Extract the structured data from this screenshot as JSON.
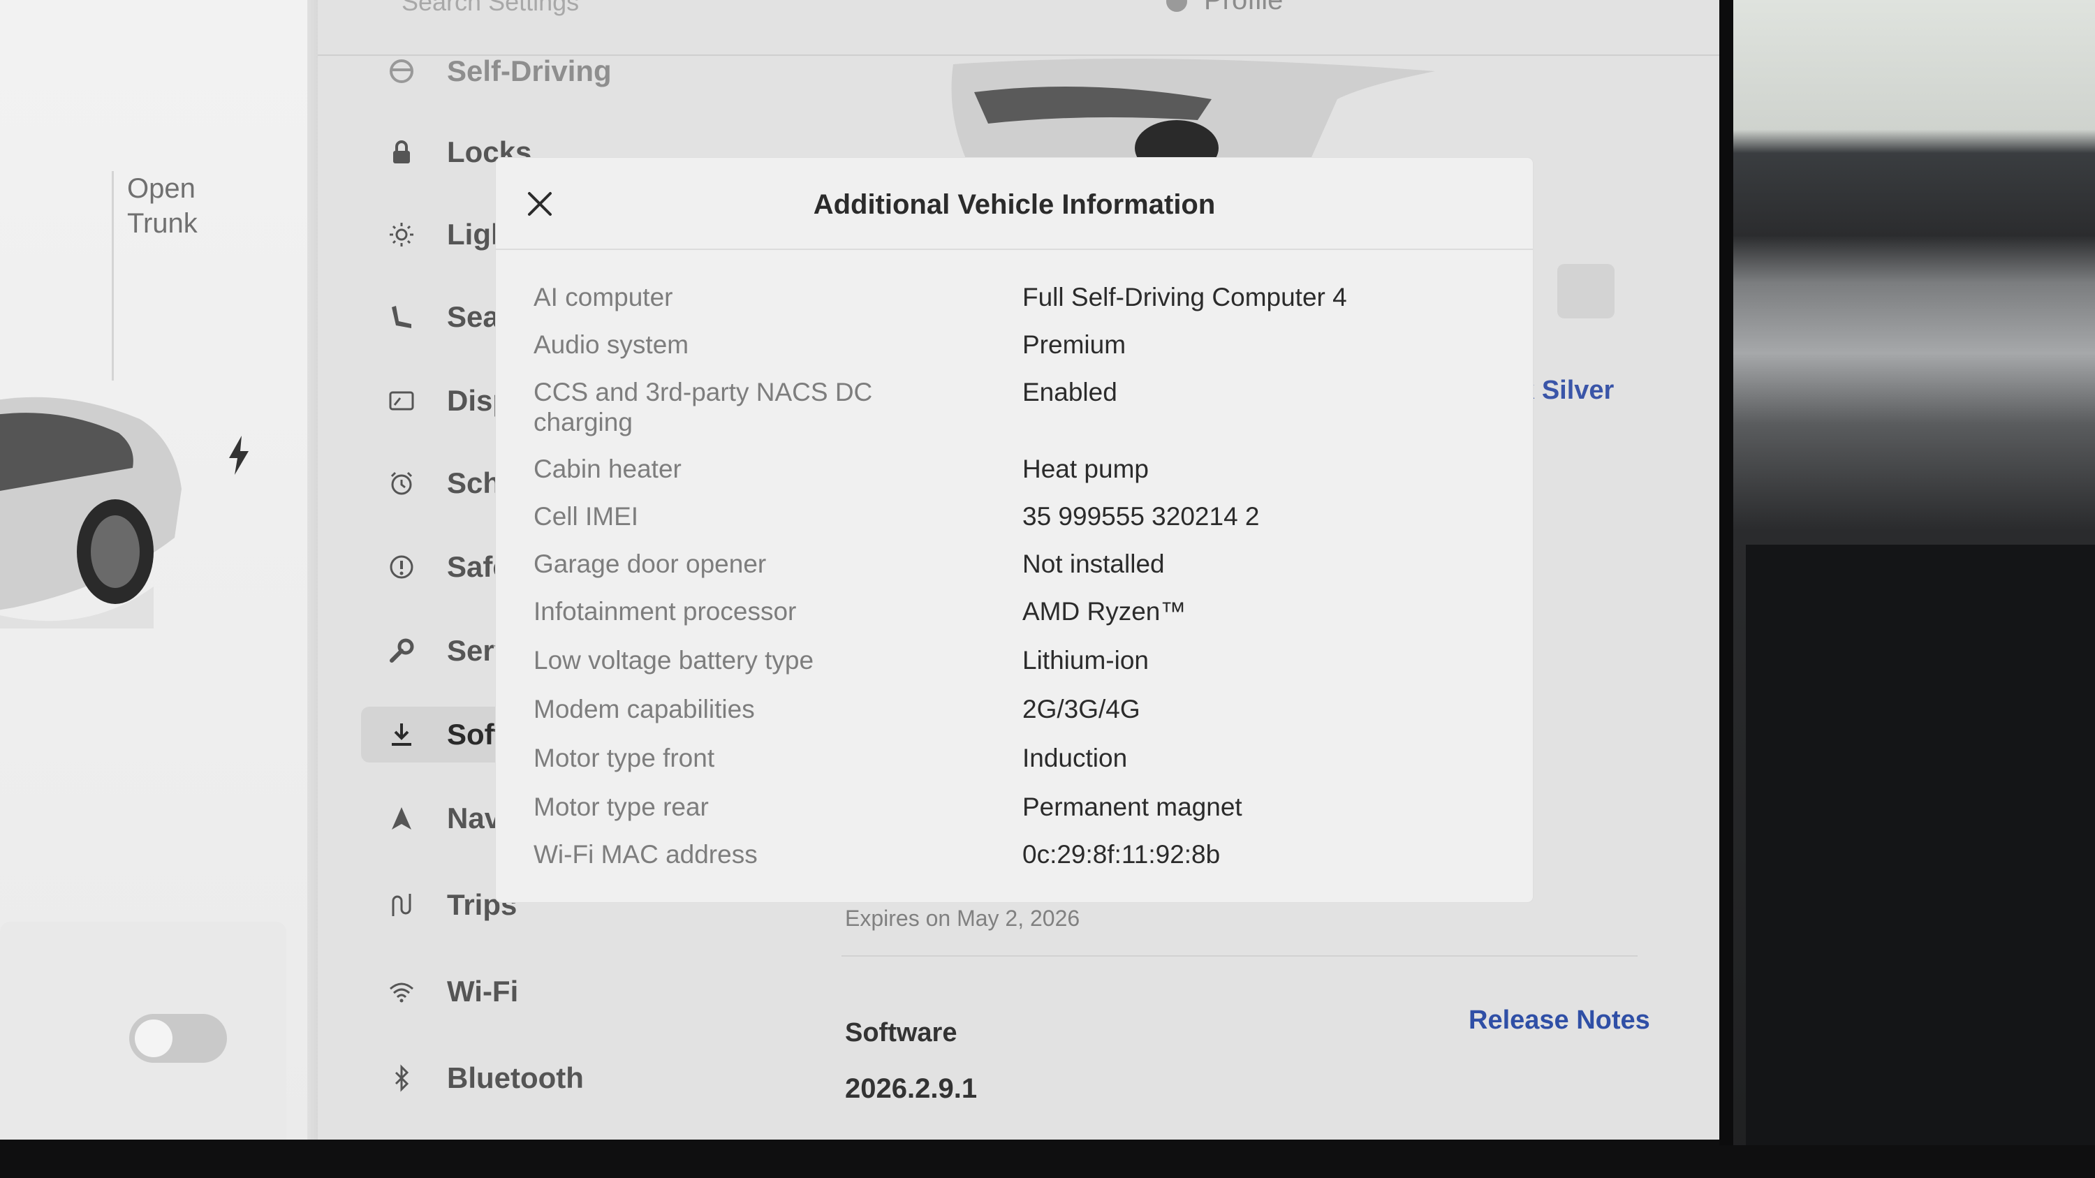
{
  "topbar": {
    "search_placeholder": "Search Settings",
    "profile_label": "Profile"
  },
  "left_panel": {
    "trunk_line1": "Open",
    "trunk_line2": "Trunk"
  },
  "nav": {
    "items": [
      {
        "label": "Self-Driving",
        "icon": "steering-wheel-icon"
      },
      {
        "label": "Locks",
        "icon": "lock-icon"
      },
      {
        "label": "Lights",
        "icon": "sun-icon"
      },
      {
        "label": "Seats",
        "icon": "seat-icon"
      },
      {
        "label": "Display",
        "icon": "display-icon"
      },
      {
        "label": "Schedule",
        "icon": "alarm-icon"
      },
      {
        "label": "Safety",
        "icon": "alert-icon"
      },
      {
        "label": "Service",
        "icon": "wrench-icon"
      },
      {
        "label": "Software",
        "icon": "download-icon",
        "selected": true
      },
      {
        "label": "Navigation",
        "icon": "navigation-icon"
      },
      {
        "label": "Trips",
        "icon": "trips-icon"
      },
      {
        "label": "Wi-Fi",
        "icon": "wifi-icon"
      },
      {
        "label": "Bluetooth",
        "icon": "bluetooth-icon"
      }
    ]
  },
  "main": {
    "color_text": "ck Silver",
    "expires": "Expires on May 2, 2026",
    "software_label": "Software",
    "software_version": "2026.2.9.1",
    "release_notes": "Release Notes"
  },
  "modal": {
    "title": "Additional Vehicle Information",
    "rows": [
      {
        "label": "AI computer",
        "value": "Full Self-Driving Computer 4"
      },
      {
        "label": "Audio system",
        "value": "Premium"
      },
      {
        "label": "CCS and 3rd-party NACS DC charging",
        "value": "Enabled"
      },
      {
        "label": "Cabin heater",
        "value": "Heat pump"
      },
      {
        "label": "Cell IMEI",
        "value": "35 999555 320214 2"
      },
      {
        "label": "Garage door opener",
        "value": "Not installed"
      },
      {
        "label": "Infotainment processor",
        "value": "AMD Ryzen™"
      },
      {
        "label": "Low voltage battery type",
        "value": "Lithium-ion"
      },
      {
        "label": "Modem capabilities",
        "value": "2G/3G/4G"
      },
      {
        "label": "Motor type front",
        "value": "Induction"
      },
      {
        "label": "Motor type rear",
        "value": "Permanent magnet"
      },
      {
        "label": "Wi-Fi MAC address",
        "value": "0c:29:8f:11:92:8b"
      }
    ]
  },
  "colors": {
    "accent_link": "#2f4fa6",
    "modal_bg": "#f0f0f0",
    "label_gray": "#7d7d7d",
    "value_dark": "#2b2b2b"
  }
}
